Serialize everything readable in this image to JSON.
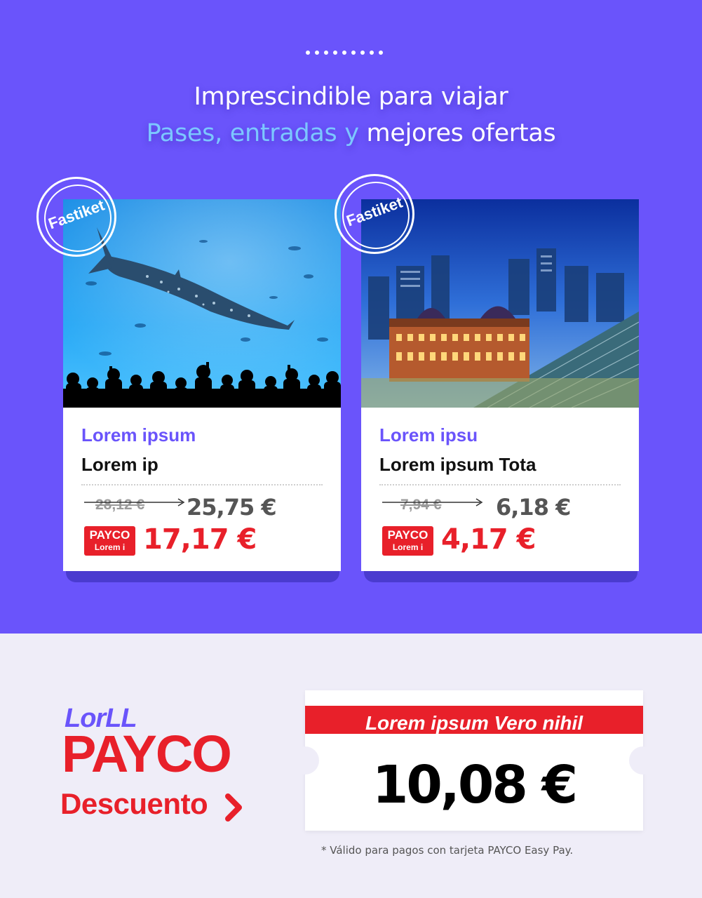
{
  "header": {
    "line1": "Imprescindible para viajar",
    "line2_accent": "Pases, entradas y",
    "line2_rest": " mejores ofertas"
  },
  "cards": [
    {
      "badge": "Fastiket",
      "image": "whale-shark-aquarium",
      "subtitle": "Lorem ipsum",
      "name": "Lorem ip",
      "old_price": "28,12 €",
      "new_price": "25,75 €",
      "payco_badge_line1": "PAYCO",
      "payco_badge_line2": "Lorem i",
      "payco_price": "17,17 €"
    },
    {
      "badge": "Fastiket",
      "image": "tokyo-station-night",
      "subtitle": "Lorem ipsu",
      "name": "Lorem ipsum Tota",
      "old_price": "7,94 €",
      "new_price": "6,18 €",
      "payco_badge_line1": "PAYCO",
      "payco_badge_line2": "Lorem i",
      "payco_price": "4,17 €"
    }
  ],
  "promo": {
    "logo_top": "LorLL",
    "logo_main": "PAYCO",
    "logo_sub": "Descuento",
    "ticket_header": "Lorem ipsum Vero nihil",
    "ticket_value": "10,08 €",
    "footnote": "* Válido para pagos con tarjeta PAYCO Easy Pay."
  },
  "colors": {
    "primary": "#6a54fb",
    "accent_text": "#7cc7ff",
    "payco_red": "#e8202a",
    "bottom_bg": "#efedf8"
  }
}
